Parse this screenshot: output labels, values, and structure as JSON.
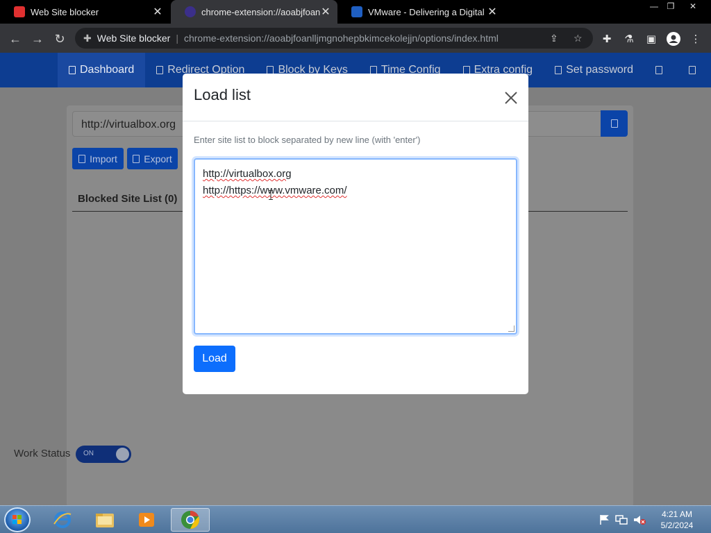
{
  "tabs": [
    {
      "title": "Web Site blocker",
      "favicon_color": "#e03030",
      "active": false
    },
    {
      "title": "chrome-extension://aoabjfoanllj",
      "favicon_color": "#3b2f8a",
      "active": true
    },
    {
      "title": "VMware - Delivering a Digital Fo",
      "favicon_color": "#1f5fc2",
      "active": false
    }
  ],
  "toolbar": {
    "site_name": "Web Site blocker",
    "url": "chrome-extension://aoabjfoanlljmgnohepbkimcekolejjn/options/index.html"
  },
  "nav": {
    "items": [
      "Dashboard",
      "Redirect Option",
      "Block by Keys",
      "Time Config",
      "Extra config",
      "Set password"
    ]
  },
  "main": {
    "url_input_value": "http://virtualbox.org",
    "import_label": "Import",
    "export_label": "Export",
    "list_title": "Blocked Site List (0)",
    "work_status_label": "Work Status",
    "toggle_label": "ON"
  },
  "modal": {
    "title": "Load list",
    "hint": "Enter site list to block separated by new line (with 'enter')",
    "lines": [
      "http://virtualbox.org",
      "http://https://www.vmware.com/"
    ],
    "load_label": "Load"
  },
  "taskbar": {
    "time": "4:21 AM",
    "date": "5/2/2024"
  },
  "colors": {
    "nav_bg": "#0d3d91",
    "primary": "#0d6efd"
  }
}
